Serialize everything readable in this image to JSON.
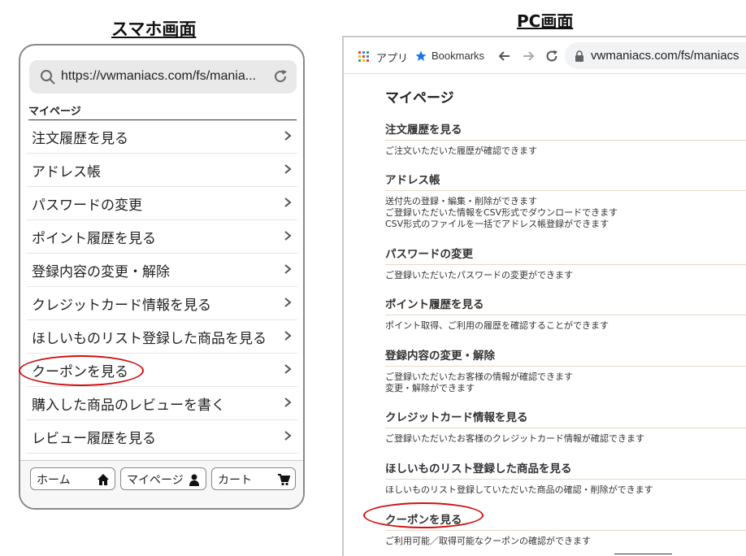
{
  "headings": {
    "mobile": "スマホ画面",
    "pc": "PC画面"
  },
  "mobile": {
    "url": "https://vwmaniacs.com/fs/mania...",
    "page_title": "マイページ",
    "menu": [
      "注文履歴を見る",
      "アドレス帳",
      "パスワードの変更",
      "ポイント履歴を見る",
      "登録内容の変更・解除",
      "クレジットカード情報を見る",
      "ほしいものリスト登録した商品を見る",
      "クーポンを見る",
      "購入した商品のレビューを書く",
      "レビュー履歴を見る"
    ],
    "bottom_nav": {
      "home": "ホーム",
      "mypage": "マイページ",
      "cart": "カート"
    }
  },
  "pc": {
    "toolbar": {
      "apps": "アプリ",
      "bookmarks": "Bookmarks",
      "url": "vwmaniacs.com/fs/maniacs"
    },
    "page_title": "マイページ",
    "sections": [
      {
        "title": "注文履歴を見る",
        "desc": [
          "ご注文いただいた履歴が確認できます"
        ]
      },
      {
        "title": "アドレス帳",
        "desc": [
          "送付先の登録・編集・削除ができます",
          "ご登録いただいた情報をCSV形式でダウンロードできます",
          "CSV形式のファイルを一括でアドレス帳登録ができます"
        ]
      },
      {
        "title": "パスワードの変更",
        "desc": [
          "ご登録いただいたパスワードの変更ができます"
        ]
      },
      {
        "title": "ポイント履歴を見る",
        "desc": [
          "ポイント取得、ご利用の履歴を確認することができます"
        ]
      },
      {
        "title": "登録内容の変更・解除",
        "desc": [
          "ご登録いただいたお客様の情報が確認できます",
          "変更・解除ができます"
        ]
      },
      {
        "title": "クレジットカード情報を見る",
        "desc": [
          "ご登録いただいたお客様のクレジットカード情報が確認できます"
        ]
      },
      {
        "title": "ほしいものリスト登録した商品を見る",
        "desc": [
          "ほしいものリスト登録していただいた商品の確認・削除ができます"
        ]
      },
      {
        "title": "クーポンを見る",
        "desc": [
          "ご利用可能／取得可能なクーポンの確認ができます"
        ]
      }
    ]
  },
  "colors": {
    "highlight": "#d01010",
    "bookmark_star": "#1a73e8"
  }
}
